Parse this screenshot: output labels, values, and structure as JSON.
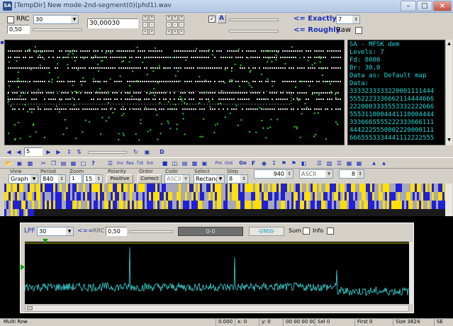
{
  "window": {
    "title": "[TempDir] New mode-2nd-segment(0)(phd1).wav",
    "app_icon": "SA"
  },
  "top_controls": {
    "rrc_label": "RRC",
    "rrc_value": "30",
    "rrc_sub_value": "0,50",
    "center_value": "30,00030",
    "mode_button": "A",
    "exactly_label": "<= Exactly",
    "roughly_label": "<= Roughly",
    "spin_value": "7",
    "raw_label": "Raw"
  },
  "info_panel": {
    "lines": [
      "SA - MFSK dem",
      "Levels: 7",
      "Fd: 8000",
      "Br: 30,0",
      "Data as: Default map",
      "Data:",
      "3333233333220001111444",
      "5552223336662114444666",
      "2220003335553332222666",
      "5553110004441110004444",
      "3336665555222333666111",
      "4442225550002220000111",
      "6665553334441112222555"
    ]
  },
  "nav": {
    "page": "5"
  },
  "toolbar": {
    "view_label": "View",
    "view_value": "Graph",
    "period_label": "Period",
    "period_value": "840",
    "zoom_label": "Zoom",
    "zoom_value": "15",
    "polarity_label": "Polarity",
    "polarity_value": "Positive",
    "order_label": "Order",
    "order_value": "Correct",
    "code_label": "Code",
    "code_value": "ASCII",
    "select_label": "Select",
    "select_value": "Rectangle",
    "step_label": "Step",
    "step_value": "8",
    "width_value": "940",
    "encoding_value": "ASCII",
    "bits_value": "8",
    "btn_pm": "Pm",
    "btn_ord": "Ord",
    "btn_go": "Go",
    "btn_f": "F",
    "btn_inv": "Inv",
    "btn_rex": "Rex",
    "btn_txt": "Txt",
    "btn_sm": "Sm"
  },
  "analyzer": {
    "lpf_label": "LPF",
    "lpf_value": "30",
    "arrow_label": "<==",
    "rrc_label": "RRC",
    "rrc_value": "0,50",
    "readout": "0-0",
    "vmw_label": "-VMW-",
    "sum_label": "Sum",
    "info_label": "Info"
  },
  "status": {
    "mode": "Multi Row",
    "value": "0.000",
    "x": "x: 0",
    "y": "y: 0",
    "hex": "00 00 00 00",
    "sel": "Sel 0",
    "first": "First 0",
    "size": "Size 3824",
    "end": "SE"
  },
  "colors": {
    "titlebar": "#b3c8e4",
    "plot_bg": "#000000",
    "dots": "#2ecc2e",
    "text_cyan": "#1fd6d6",
    "bit_yellow": "#ffe000",
    "bit_blue": "#2020d8",
    "trace": "#3fd6d6",
    "toolbar_blue": "#1b2fb8",
    "marker_green": "#0aa00a"
  },
  "icons": [
    "app-icon",
    "checkbox-icon",
    "dropdown-arrow-icon",
    "spin-icon",
    "first-page-icon",
    "prev-page-icon",
    "next-page-icon",
    "last-page-icon",
    "open-icon",
    "save-icon",
    "cut-icon",
    "copy-icon",
    "paste-icon",
    "help-icon",
    "binoculars-icon",
    "grid-icon",
    "marker-icon"
  ]
}
